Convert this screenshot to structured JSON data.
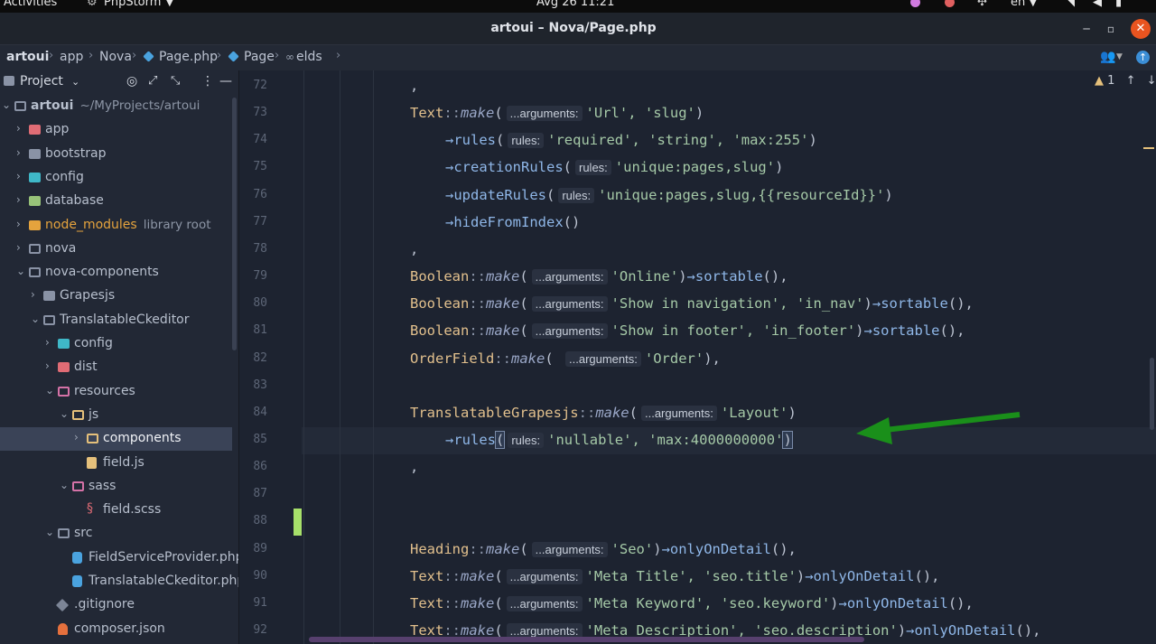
{
  "system_bar": {
    "activities": "Activities",
    "app": "PhpStorm",
    "clock": "Avg 26  11:21",
    "lang": "en"
  },
  "window": {
    "title": "artoui – Nova/Page.php"
  },
  "breadcrumb": [
    "artoui",
    "app",
    "Nova",
    "Page.php",
    "Page",
    "elds"
  ],
  "project_panel": {
    "title": "Project",
    "tree": [
      {
        "label": "artoui",
        "extra": "~/MyProjects/artoui",
        "icon": "folder-open",
        "arrow": "down"
      },
      {
        "label": "app",
        "icon": "red",
        "arrow": "right"
      },
      {
        "label": "bootstrap",
        "icon": "folder",
        "arrow": "right"
      },
      {
        "label": "config",
        "icon": "cyan",
        "arrow": "right"
      },
      {
        "label": "database",
        "icon": "green",
        "arrow": "right"
      },
      {
        "label": "node_modules",
        "extra": "library root",
        "icon": "orange",
        "arrow": "right"
      },
      {
        "label": "nova",
        "icon": "folder-open",
        "arrow": "right"
      },
      {
        "label": "nova-components",
        "icon": "folder-open",
        "arrow": "down"
      },
      {
        "label": "Grapesjs",
        "icon": "folder",
        "arrow": "right"
      },
      {
        "label": "TranslatableCkeditor",
        "icon": "folder-open",
        "arrow": "down"
      },
      {
        "label": "config",
        "icon": "cyan",
        "arrow": "right"
      },
      {
        "label": "dist",
        "icon": "red",
        "arrow": "right"
      },
      {
        "label": "resources",
        "icon": "pink",
        "arrow": "down"
      },
      {
        "label": "js",
        "icon": "yellowo",
        "arrow": "down"
      },
      {
        "label": "components",
        "icon": "yellowo",
        "arrow": "right",
        "selected": true
      },
      {
        "label": "field.js",
        "icon": "jsfile",
        "arrow": ""
      },
      {
        "label": "sass",
        "icon": "pink",
        "arrow": "down"
      },
      {
        "label": "field.scss",
        "icon": "scss",
        "arrow": ""
      },
      {
        "label": "src",
        "icon": "folder-open",
        "arrow": "down"
      },
      {
        "label": "FieldServiceProvider.php",
        "icon": "php",
        "arrow": ""
      },
      {
        "label": "TranslatableCkeditor.php",
        "icon": "php",
        "arrow": ""
      },
      {
        "label": ".gitignore",
        "icon": "git",
        "arrow": ""
      },
      {
        "label": "composer.json",
        "icon": "json",
        "arrow": ""
      }
    ]
  },
  "editor": {
    "warnings": "1",
    "lines": [
      {
        "num": "72",
        "tokens": [
          {
            "t": ",",
            "c": "k-punc"
          }
        ]
      },
      {
        "num": "73",
        "tokens": [
          {
            "t": "Text",
            "c": "k-class"
          },
          {
            "t": "::",
            "c": "k-op"
          },
          {
            "t": "make",
            "c": "k-call"
          },
          {
            "t": "(",
            "c": "k-punc"
          },
          {
            "t": "...arguments:",
            "c": "hint"
          },
          {
            "t": "'Url', 'slug'",
            "c": "k-str"
          },
          {
            "t": ")",
            "c": "k-punc"
          }
        ]
      },
      {
        "num": "74",
        "tokens": [
          {
            "t": "→rules",
            "c": "k-meth"
          },
          {
            "t": "(",
            "c": "k-punc"
          },
          {
            "t": "rules:",
            "c": "hint"
          },
          {
            "t": "'required', 'string', 'max:255'",
            "c": "k-str"
          },
          {
            "t": ")",
            "c": "k-punc"
          }
        ]
      },
      {
        "num": "75",
        "tokens": [
          {
            "t": "→creationRules",
            "c": "k-meth"
          },
          {
            "t": "(",
            "c": "k-punc"
          },
          {
            "t": "rules:",
            "c": "hint"
          },
          {
            "t": "'unique:pages,slug'",
            "c": "k-str"
          },
          {
            "t": ")",
            "c": "k-punc"
          }
        ]
      },
      {
        "num": "76",
        "tokens": [
          {
            "t": "→updateRules",
            "c": "k-meth"
          },
          {
            "t": "(",
            "c": "k-punc"
          },
          {
            "t": "rules:",
            "c": "hint"
          },
          {
            "t": "'unique:pages,slug,{{resourceId}}'",
            "c": "k-str"
          },
          {
            "t": ")",
            "c": "k-punc"
          }
        ]
      },
      {
        "num": "77",
        "tokens": [
          {
            "t": "→hideFromIndex",
            "c": "k-meth"
          },
          {
            "t": "()",
            "c": "k-punc"
          }
        ]
      },
      {
        "num": "78",
        "tokens": [
          {
            "t": ",",
            "c": "k-punc"
          }
        ]
      },
      {
        "num": "79",
        "tokens": [
          {
            "t": "Boolean",
            "c": "k-class"
          },
          {
            "t": "::",
            "c": "k-op"
          },
          {
            "t": "make",
            "c": "k-call"
          },
          {
            "t": "(",
            "c": "k-punc"
          },
          {
            "t": "...arguments:",
            "c": "hint"
          },
          {
            "t": "'Online'",
            "c": "k-str"
          },
          {
            "t": ")",
            "c": "k-punc"
          },
          {
            "t": "→sortable",
            "c": "k-meth"
          },
          {
            "t": "(),",
            "c": "k-punc"
          }
        ]
      },
      {
        "num": "80",
        "tokens": [
          {
            "t": "Boolean",
            "c": "k-class"
          },
          {
            "t": "::",
            "c": "k-op"
          },
          {
            "t": "make",
            "c": "k-call"
          },
          {
            "t": "(",
            "c": "k-punc"
          },
          {
            "t": "...arguments:",
            "c": "hint"
          },
          {
            "t": "'Show in navigation', 'in_nav'",
            "c": "k-str"
          },
          {
            "t": ")",
            "c": "k-punc"
          },
          {
            "t": "→sortable",
            "c": "k-meth"
          },
          {
            "t": "(),",
            "c": "k-punc"
          }
        ]
      },
      {
        "num": "81",
        "tokens": [
          {
            "t": "Boolean",
            "c": "k-class"
          },
          {
            "t": "::",
            "c": "k-op"
          },
          {
            "t": "make",
            "c": "k-call"
          },
          {
            "t": "(",
            "c": "k-punc"
          },
          {
            "t": "...arguments:",
            "c": "hint"
          },
          {
            "t": "'Show in footer', 'in_footer'",
            "c": "k-str"
          },
          {
            "t": ")",
            "c": "k-punc"
          },
          {
            "t": "→sortable",
            "c": "k-meth"
          },
          {
            "t": "(),",
            "c": "k-punc"
          }
        ]
      },
      {
        "num": "82",
        "tokens": [
          {
            "t": "OrderField",
            "c": "k-class"
          },
          {
            "t": "::",
            "c": "k-op"
          },
          {
            "t": "make",
            "c": "k-call"
          },
          {
            "t": "( ",
            "c": "k-punc"
          },
          {
            "t": "...arguments:",
            "c": "hint"
          },
          {
            "t": "'Order'",
            "c": "k-str"
          },
          {
            "t": "),",
            "c": "k-punc"
          }
        ]
      },
      {
        "num": "83",
        "tokens": []
      },
      {
        "num": "84",
        "tokens": [
          {
            "t": "TranslatableGrapesjs",
            "c": "k-class"
          },
          {
            "t": "::",
            "c": "k-op"
          },
          {
            "t": "make",
            "c": "k-call"
          },
          {
            "t": "(",
            "c": "k-punc"
          },
          {
            "t": "...arguments:",
            "c": "hint"
          },
          {
            "t": "'Layout'",
            "c": "k-str"
          },
          {
            "t": ")",
            "c": "k-punc"
          }
        ]
      },
      {
        "num": "85",
        "tokens": [
          {
            "t": "→rules",
            "c": "k-meth"
          },
          {
            "t": "(",
            "c": "k-punc bracket-box"
          },
          {
            "t": "rules:",
            "c": "hint"
          },
          {
            "t": "'nullable', 'max:4000000000'",
            "c": "k-str"
          },
          {
            "t": ")",
            "c": "k-punc bracket-box"
          }
        ]
      },
      {
        "num": "86",
        "tokens": [
          {
            "t": ",",
            "c": "k-punc"
          }
        ]
      },
      {
        "num": "87",
        "tokens": []
      },
      {
        "num": "88",
        "tokens": []
      },
      {
        "num": "89",
        "tokens": [
          {
            "t": "Heading",
            "c": "k-class"
          },
          {
            "t": "::",
            "c": "k-op"
          },
          {
            "t": "make",
            "c": "k-call"
          },
          {
            "t": "(",
            "c": "k-punc"
          },
          {
            "t": "...arguments:",
            "c": "hint"
          },
          {
            "t": "'Seo'",
            "c": "k-str"
          },
          {
            "t": ")",
            "c": "k-punc"
          },
          {
            "t": "→onlyOnDetail",
            "c": "k-meth"
          },
          {
            "t": "(),",
            "c": "k-punc"
          }
        ]
      },
      {
        "num": "90",
        "tokens": [
          {
            "t": "Text",
            "c": "k-class"
          },
          {
            "t": "::",
            "c": "k-op"
          },
          {
            "t": "make",
            "c": "k-call"
          },
          {
            "t": "(",
            "c": "k-punc"
          },
          {
            "t": "...arguments:",
            "c": "hint"
          },
          {
            "t": "'Meta Title', 'seo.title'",
            "c": "k-str"
          },
          {
            "t": ")",
            "c": "k-punc"
          },
          {
            "t": "→onlyOnDetail",
            "c": "k-meth"
          },
          {
            "t": "(),",
            "c": "k-punc"
          }
        ]
      },
      {
        "num": "91",
        "tokens": [
          {
            "t": "Text",
            "c": "k-class"
          },
          {
            "t": "::",
            "c": "k-op"
          },
          {
            "t": "make",
            "c": "k-call"
          },
          {
            "t": "(",
            "c": "k-punc"
          },
          {
            "t": "...arguments:",
            "c": "hint"
          },
          {
            "t": "'Meta Keyword', 'seo.keyword'",
            "c": "k-str"
          },
          {
            "t": ")",
            "c": "k-punc"
          },
          {
            "t": "→onlyOnDetail",
            "c": "k-meth"
          },
          {
            "t": "(),",
            "c": "k-punc"
          }
        ]
      },
      {
        "num": "92",
        "tokens": [
          {
            "t": "Text",
            "c": "k-class"
          },
          {
            "t": "::",
            "c": "k-op"
          },
          {
            "t": "make",
            "c": "k-call"
          },
          {
            "t": "(",
            "c": "k-punc"
          },
          {
            "t": "...arguments:",
            "c": "hint"
          },
          {
            "t": "'Meta Description', 'seo.description'",
            "c": "k-str"
          },
          {
            "t": ")",
            "c": "k-punc"
          },
          {
            "t": "→onlyOnDetail",
            "c": "k-meth"
          },
          {
            "t": "(),",
            "c": "k-punc"
          }
        ]
      }
    ]
  },
  "annotation_arrow_color": "#1a8f1a"
}
